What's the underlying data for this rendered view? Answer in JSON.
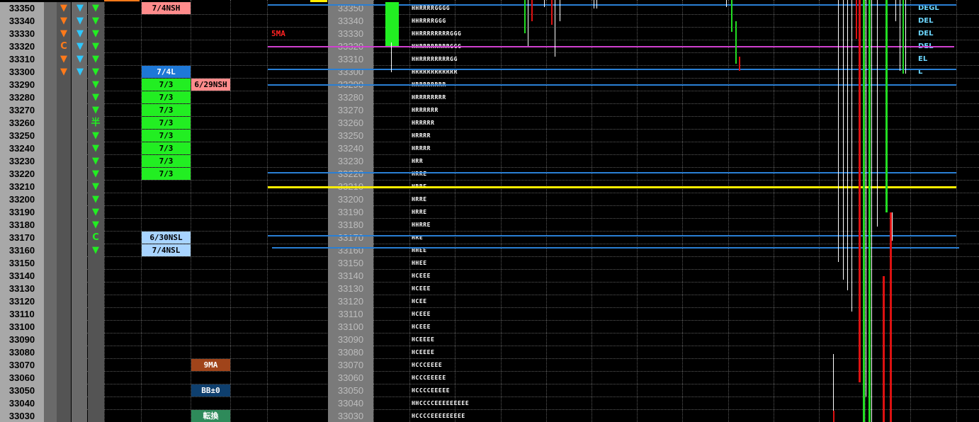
{
  "prices": [
    "33350",
    "33340",
    "33330",
    "33320",
    "33310",
    "33300",
    "33290",
    "33280",
    "33270",
    "33260",
    "33250",
    "33240",
    "33230",
    "33220",
    "33210",
    "33200",
    "33190",
    "33180",
    "33170",
    "33160",
    "33150",
    "33140",
    "33130",
    "33120",
    "33110",
    "33100",
    "33090",
    "33080",
    "33070",
    "33060",
    "33050",
    "33040",
    "33030"
  ],
  "indicator_rows": [
    [
      "tri-down-orange",
      "tri-down-cyan",
      "tri-down-green"
    ],
    [
      "tri-down-orange",
      "tri-down-cyan",
      "tri-down-green"
    ],
    [
      "tri-down-orange",
      "tri-down-cyan",
      "tri-down-green"
    ],
    [
      "C-orange",
      "tri-down-cyan",
      "tri-down-green"
    ],
    [
      "tri-down-orange",
      "tri-down-cyan",
      "tri-down-green"
    ],
    [
      "tri-down-orange",
      "tri-down-cyan",
      "tri-down-green"
    ],
    [
      "",
      "",
      "tri-down-green"
    ],
    [
      "",
      "",
      "tri-down-green"
    ],
    [
      "",
      "",
      "tri-down-green"
    ],
    [
      "",
      "",
      "半-green"
    ],
    [
      "",
      "",
      "tri-down-green"
    ],
    [
      "",
      "",
      "tri-down-green"
    ],
    [
      "",
      "",
      "tri-down-green"
    ],
    [
      "",
      "",
      "tri-down-green"
    ],
    [
      "",
      "",
      "tri-down-green"
    ],
    [
      "",
      "",
      "tri-down-green"
    ],
    [
      "",
      "",
      "tri-down-green"
    ],
    [
      "",
      "",
      "tri-down-green"
    ],
    [
      "",
      "",
      "C-green"
    ],
    [
      "",
      "",
      "tri-down-green"
    ]
  ],
  "indicator_text": {
    "C": "C",
    "han": "半"
  },
  "tags_col1": [
    {
      "row": 0,
      "text": "7/4NSH",
      "bg": "#ff8c8c",
      "dark": true
    },
    {
      "row": 5,
      "text": "7/4L",
      "bg": "#1e78d7",
      "dark": false
    },
    {
      "row": 6,
      "text": "7/3",
      "bg": "#22ee22",
      "dark": true
    },
    {
      "row": 7,
      "text": "7/3",
      "bg": "#22ee22",
      "dark": true
    },
    {
      "row": 8,
      "text": "7/3",
      "bg": "#22ee22",
      "dark": true
    },
    {
      "row": 9,
      "text": "7/3",
      "bg": "#22ee22",
      "dark": true
    },
    {
      "row": 10,
      "text": "7/3",
      "bg": "#22ee22",
      "dark": true
    },
    {
      "row": 11,
      "text": "7/3",
      "bg": "#22ee22",
      "dark": true
    },
    {
      "row": 12,
      "text": "7/3",
      "bg": "#22ee22",
      "dark": true
    },
    {
      "row": 13,
      "text": "7/3",
      "bg": "#22ee22",
      "dark": true
    },
    {
      "row": 18,
      "text": "6/30NSL",
      "bg": "#a8d4ff",
      "dark": true
    },
    {
      "row": 19,
      "text": "7/4NSL",
      "bg": "#a8d4ff",
      "dark": true
    }
  ],
  "tags_col2": [
    {
      "row": 6,
      "text": "6/29NSH",
      "bg": "#ff8c8c",
      "dark": true
    },
    {
      "row": 28,
      "text": "9MA",
      "bg": "#a0441a",
      "dark": false
    },
    {
      "row": 30,
      "text": "BB±0",
      "bg": "#0e3f6e",
      "dark": false
    },
    {
      "row": 32,
      "text": "転換",
      "bg": "#2e8a5a",
      "dark": false
    }
  ],
  "ma5_label": "5MA",
  "profile_letters": [
    "HHRRRRGGGG",
    "HHRRRRGGG",
    "HHRRRRRRRRGGG",
    "HHRRRRRRRRGGG",
    "HHRRRRRRRRGG",
    "HRRRRRRRRRRR",
    "HRRRRRRRR",
    "HRRRRRRRR",
    "HRRRRRR",
    "HRRRRR",
    "HRRRR",
    "HRRRR",
    "HRR",
    "HRRE",
    "HRRE",
    "HRRE",
    "HRRE",
    "HHRRE",
    "HRE",
    "HHEE",
    "HHEE",
    "HCEEE",
    "HCEEE",
    "HCEE",
    "HCEEE",
    "HCEEE",
    "HCEEEE",
    "HCEEEE",
    "HCCCEEEE",
    "HCCCEEEEE",
    "HCCCCEEEEE",
    "HHCCCCEEEEEEEEE",
    "HCCCCEEEEEEEEE"
  ],
  "right_labels": [
    {
      "row": 0,
      "text": "DEGL"
    },
    {
      "row": 1,
      "text": "DEL"
    },
    {
      "row": 2,
      "text": "DEL"
    },
    {
      "row": 3,
      "text": "DEL"
    },
    {
      "row": 4,
      "text": "EL"
    },
    {
      "row": 5,
      "text": "L"
    }
  ],
  "colors": {
    "price_bg": "#a8a8a8",
    "grid": "#5a5a5a",
    "blue_line": "#2a7fd4",
    "yellow_line": "#ffee00",
    "magenta_line": "#d040d0",
    "green": "#22dd22",
    "red": "#dd1111",
    "label_cyan": "#6cd7ff"
  }
}
